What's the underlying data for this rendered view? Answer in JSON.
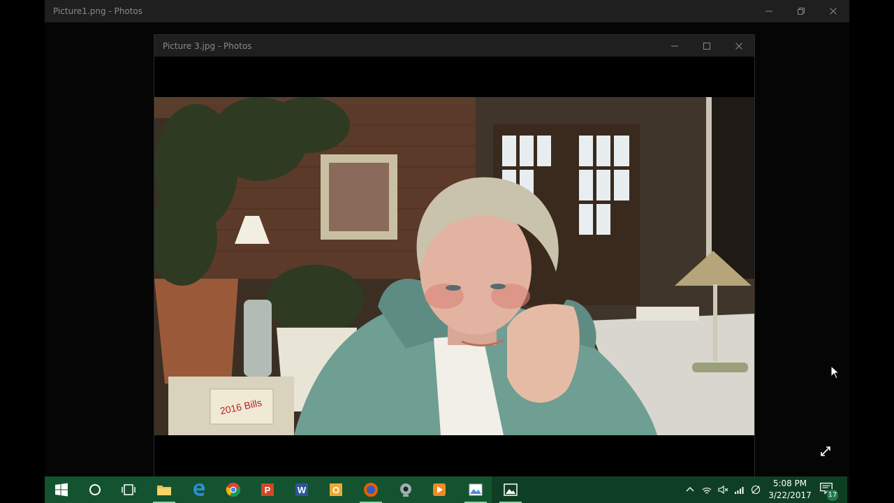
{
  "back_window": {
    "title": "Picture1.png - Photos"
  },
  "front_window": {
    "title": "Picture 3.jpg - Photos"
  },
  "photo": {
    "sign_text": "2016 Bills"
  },
  "taskbar": {
    "apps": [
      {
        "name": "start",
        "icon": "windows-logo"
      },
      {
        "name": "cortana",
        "icon": "cortana-circle"
      },
      {
        "name": "task-view",
        "icon": "task-view"
      },
      {
        "name": "file-explorer",
        "icon": "folder"
      },
      {
        "name": "edge",
        "icon": "edge-e"
      },
      {
        "name": "chrome",
        "icon": "chrome"
      },
      {
        "name": "powerpoint",
        "icon": "powerpoint"
      },
      {
        "name": "word",
        "icon": "word"
      },
      {
        "name": "outlook",
        "icon": "outlook"
      },
      {
        "name": "firefox",
        "icon": "firefox"
      },
      {
        "name": "webcam",
        "icon": "webcam"
      },
      {
        "name": "media-player",
        "icon": "play"
      },
      {
        "name": "photos-1",
        "icon": "photo"
      },
      {
        "name": "photos-2",
        "icon": "photo"
      }
    ],
    "clock": {
      "time": "5:08 PM",
      "date": "3/22/2017"
    },
    "notifications": {
      "count": "17"
    }
  },
  "colors": {
    "taskbar": "#14532f",
    "titlebar": "#1f1f1f"
  }
}
